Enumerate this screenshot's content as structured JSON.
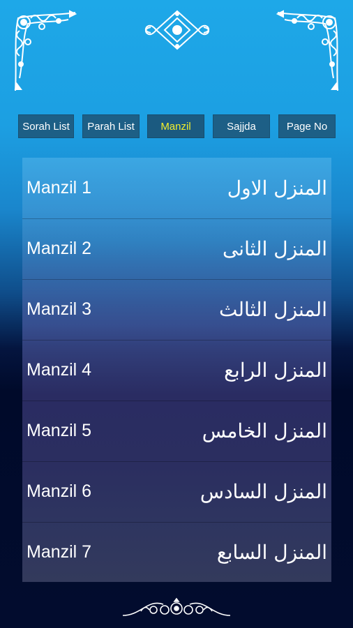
{
  "tabs": [
    {
      "label": "Sorah List",
      "active": false
    },
    {
      "label": "Parah List",
      "active": false
    },
    {
      "label": "Manzil",
      "active": true
    },
    {
      "label": "Sajjda",
      "active": false
    },
    {
      "label": "Page No",
      "active": false
    }
  ],
  "manzils": [
    {
      "english": "Manzil 1",
      "arabic": "المنزل الاول"
    },
    {
      "english": "Manzil 2",
      "arabic": "المنزل الثانی"
    },
    {
      "english": "Manzil 3",
      "arabic": "المنزل الثالث"
    },
    {
      "english": "Manzil 4",
      "arabic": "المنزل الرابع"
    },
    {
      "english": "Manzil 5",
      "arabic": "المنزل الخامس"
    },
    {
      "english": "Manzil 6",
      "arabic": "المنزل السادس"
    },
    {
      "english": "Manzil 7",
      "arabic": "المنزل السابع"
    }
  ],
  "colors": {
    "active_tab_text": "#f2ee2c",
    "tab_background": "#1d5f86",
    "ornament": "#ffffff"
  },
  "icons": [
    "corner-ornament-left-icon",
    "corner-ornament-right-icon",
    "medallion-ornament-icon",
    "divider-ornament-icon"
  ]
}
